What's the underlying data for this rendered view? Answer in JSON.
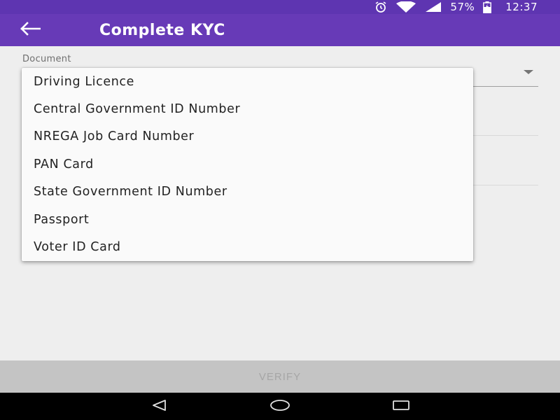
{
  "status_bar": {
    "battery": "57%",
    "time": "12:37",
    "icons": [
      "alarm-icon",
      "wifi-icon",
      "signal-icon",
      "battery-icon"
    ]
  },
  "app_bar": {
    "back_icon": "arrow-back-icon",
    "title": "Complete KYC"
  },
  "form": {
    "document_label": "Document"
  },
  "dropdown_menu": {
    "items": [
      "Driving Licence",
      "Central Government ID Number",
      "NREGA Job Card Number",
      "PAN Card",
      "State Government ID Number",
      "Passport",
      "Voter ID Card"
    ]
  },
  "verify_button": {
    "label": "VERIFY"
  },
  "nav_bar": {
    "icons": [
      "back-triangle-icon",
      "home-circle-icon",
      "recents-square-icon"
    ]
  },
  "colors": {
    "status_bar": "#5e35b1",
    "app_bar": "#673ab7",
    "background": "#eeeeee",
    "menu_background": "#fafafa",
    "verify_disabled": "#c4c4c4"
  }
}
